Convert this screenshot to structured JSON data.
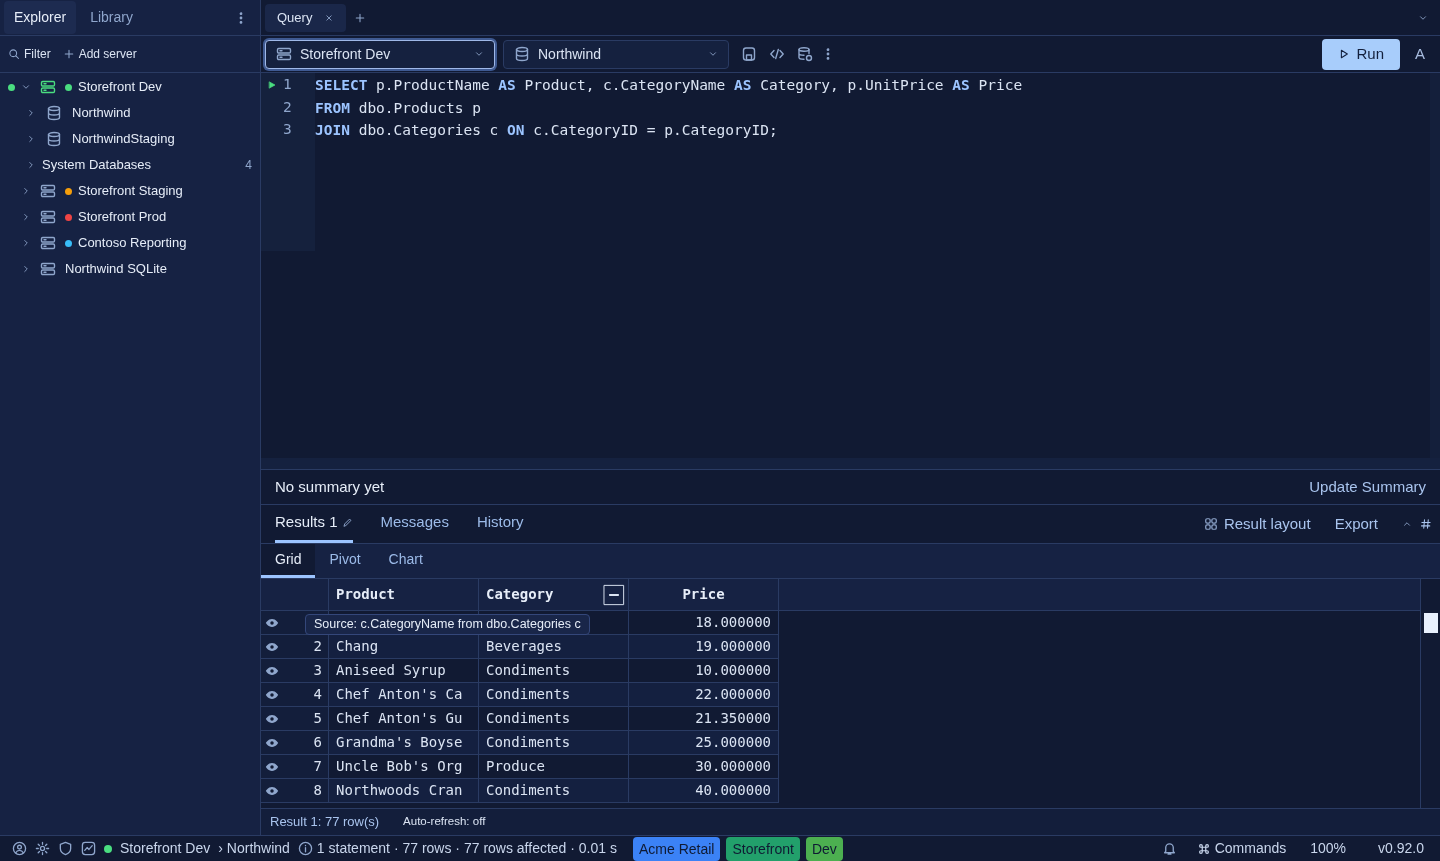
{
  "sidebar": {
    "tabs": [
      {
        "label": "Explorer",
        "selected": true
      },
      {
        "label": "Library",
        "selected": false
      }
    ],
    "toolbar": [
      "Filter",
      "Add server"
    ],
    "tree": [
      {
        "label": "Storefront Dev",
        "kind": "server",
        "connected": true,
        "color": "#4ade80",
        "expanded": true,
        "children": [
          {
            "label": "Northwind",
            "kind": "database",
            "expanded": false
          },
          {
            "label": "NorthwindStaging",
            "kind": "database",
            "expanded": false
          },
          {
            "label": "System Databases",
            "kind": "folder",
            "expanded": false,
            "count": "4"
          }
        ]
      },
      {
        "label": "Storefront Staging",
        "kind": "server",
        "connected": false,
        "color": "#f59e0b",
        "expanded": false
      },
      {
        "label": "Storefront Prod",
        "kind": "server",
        "connected": false,
        "color": "#ef4444",
        "expanded": false
      },
      {
        "label": "Contoso Reporting",
        "kind": "server",
        "connected": false,
        "color": "#38bdf8",
        "expanded": false
      },
      {
        "label": "Northwind SQLite",
        "kind": "server",
        "connected": false,
        "expanded": false
      }
    ]
  },
  "tabs": [
    {
      "label": "Query",
      "selected": true
    }
  ],
  "toolbar": {
    "server": "Storefront Dev",
    "database": "Northwind",
    "run": "Run",
    "extra": "A"
  },
  "editor": {
    "lines": [
      {
        "number": "1",
        "current": true,
        "text": "**SELECT** p.ProductName **AS** Product, c.CategoryName **AS** Category, p.UnitPrice **AS** Price"
      },
      {
        "number": "2",
        "current": false,
        "text": "**FROM** dbo.Products p"
      },
      {
        "number": "3",
        "current": false,
        "text": "**JOIN** dbo.Categories c **ON** c.CategoryID = p.CategoryID;"
      }
    ]
  },
  "summary": {
    "text": "No summary yet",
    "action": "Update Summary"
  },
  "result_tabs": [
    {
      "label": "Results 1",
      "selected": true,
      "editable": true
    },
    {
      "label": "Messages",
      "selected": false
    },
    {
      "label": "History",
      "selected": false
    }
  ],
  "result_actions": [
    "Result layout",
    "Export"
  ],
  "view_tabs": [
    {
      "label": "Grid",
      "selected": true
    },
    {
      "label": "Pivot",
      "selected": false
    },
    {
      "label": "Chart",
      "selected": false
    }
  ],
  "table": {
    "columns": [
      "Product",
      "Category",
      "Price"
    ],
    "rows": [
      {
        "price": "18.000000"
      },
      {
        "number": "2",
        "product": "Chang",
        "category": "Beverages",
        "price": "19.000000"
      },
      {
        "number": "3",
        "product": "Aniseed Syrup",
        "category": "Condiments",
        "price": "10.000000"
      },
      {
        "number": "4",
        "product": "Chef Anton's Ca",
        "category": "Condiments",
        "price": "22.000000"
      },
      {
        "number": "5",
        "product": "Chef Anton's Gu",
        "category": "Condiments",
        "price": "21.350000"
      },
      {
        "number": "6",
        "product": "Grandma's Boyse",
        "category": "Condiments",
        "price": "25.000000"
      },
      {
        "number": "7",
        "product": "Uncle Bob's Org",
        "category": "Produce",
        "price": "30.000000"
      },
      {
        "number": "8",
        "product": "Northwoods Cran",
        "category": "Condiments",
        "price": "40.000000"
      }
    ],
    "tooltip": "Source: c.CategoryName from dbo.Categories c"
  },
  "result_footer": {
    "rows": "Result 1: 77 row(s)",
    "refresh": "Auto-refresh: off"
  },
  "status_bar": {
    "connected": true,
    "server": "Storefront Dev",
    "database": "› Northwind",
    "info": "1 statement · 77 rows · 77 rows affected · 0.01 s",
    "tags": [
      {
        "label": "Acme Retail",
        "color": "#3b82f6"
      },
      {
        "label": "Storefront",
        "color": "#22a06b"
      },
      {
        "label": "Dev",
        "color": "#4caf50"
      }
    ],
    "commands": "Commands",
    "zoom": "100%",
    "version": "v0.92.0"
  }
}
